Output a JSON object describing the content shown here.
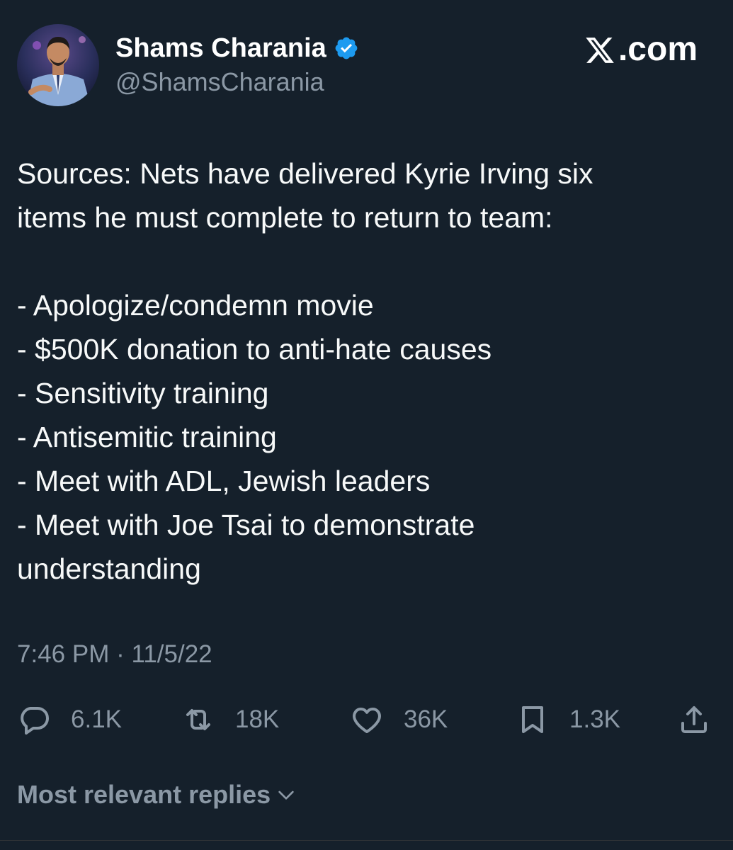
{
  "theme": {
    "background": "#15202b",
    "text_primary": "#f7f9f9",
    "text_secondary": "#8b98a5",
    "verified_blue": "#1d9bf0"
  },
  "author": {
    "display_name": "Shams Charania",
    "handle": "@ShamsCharania",
    "verified": true,
    "avatar_icon": "profile-photo"
  },
  "brand": {
    "label": ".com",
    "icon": "x-logo-icon"
  },
  "tweet": {
    "lines": [
      "Sources: Nets have delivered Kyrie Irving six",
      "items he must complete to return to team:",
      "",
      "- Apologize/condemn movie",
      "- $500K donation to anti-hate causes",
      "- Sensitivity training",
      "- Antisemitic training",
      "- Meet with ADL, Jewish leaders",
      "- Meet with Joe Tsai to demonstrate",
      "understanding"
    ],
    "timestamp": "7:46 PM · 11/5/22"
  },
  "actions": {
    "reply": {
      "icon": "reply-icon",
      "count": "6.1K"
    },
    "retweet": {
      "icon": "retweet-icon",
      "count": "18K"
    },
    "like": {
      "icon": "heart-icon",
      "count": "36K"
    },
    "bookmark": {
      "icon": "bookmark-icon",
      "count": "1.3K"
    },
    "share": {
      "icon": "share-icon"
    }
  },
  "replies_filter": {
    "label": "Most relevant replies",
    "icon": "chevron-down-icon"
  }
}
